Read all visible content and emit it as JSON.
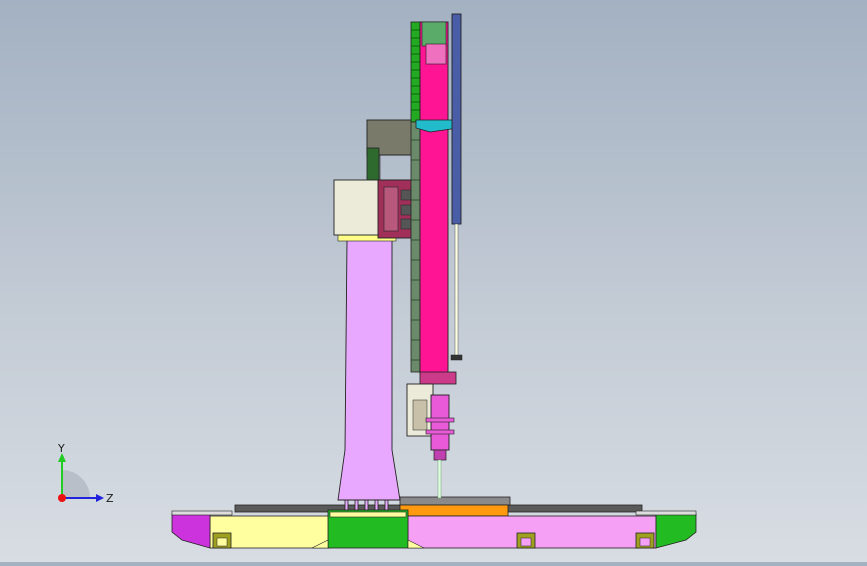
{
  "viewport": {
    "background_top": "#a3b1c2",
    "background_bottom": "#d8dde3"
  },
  "model_colors": {
    "column": "#e8a8ff",
    "base_left": "#ffffa0",
    "base_right": "#f5a0f5",
    "base_center": "#22bb22",
    "carriage": "#ff1493",
    "head_box": "#ecebd9",
    "motor": "#7a7a6a",
    "spindle": "#e85ad8",
    "rail": "#4a5ea8",
    "gear_rack": "#22aa22",
    "wedge": "#cc44cc",
    "slot_block": "#a0a020",
    "top_plate": "#555555",
    "orange_bar": "#ff9a10"
  },
  "triad": {
    "y_label": "Y",
    "z_label": "Z",
    "x_color": "#e11",
    "y_color": "#2c2",
    "z_color": "#22d"
  }
}
